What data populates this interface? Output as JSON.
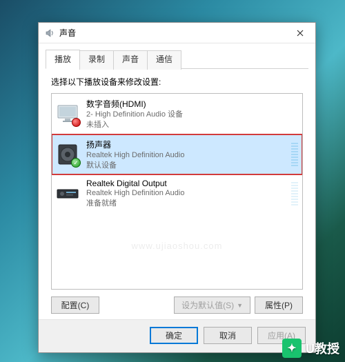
{
  "window": {
    "title": "声音"
  },
  "tabs": {
    "playback": "播放",
    "recording": "录制",
    "sounds": "声音",
    "communications": "通信"
  },
  "instruction": "选择以下播放设备来修改设置:",
  "devices": [
    {
      "name": "数字音频(HDMI)",
      "driver": "2- High Definition Audio 设备",
      "status": "未插入",
      "badge": "red"
    },
    {
      "name": "扬声器",
      "driver": "Realtek High Definition Audio",
      "status": "默认设备",
      "badge": "green"
    },
    {
      "name": "Realtek Digital Output",
      "driver": "Realtek High Definition Audio",
      "status": "准备就绪",
      "badge": "none"
    }
  ],
  "buttons": {
    "configure": "配置(C)",
    "setdefault": "设为默认值(S)",
    "properties": "属性(P)",
    "ok": "确定",
    "cancel": "取消",
    "apply": "应用(A)"
  },
  "watermark": {
    "faint": "www.ujiaoshou.com",
    "brand": "U教授"
  }
}
